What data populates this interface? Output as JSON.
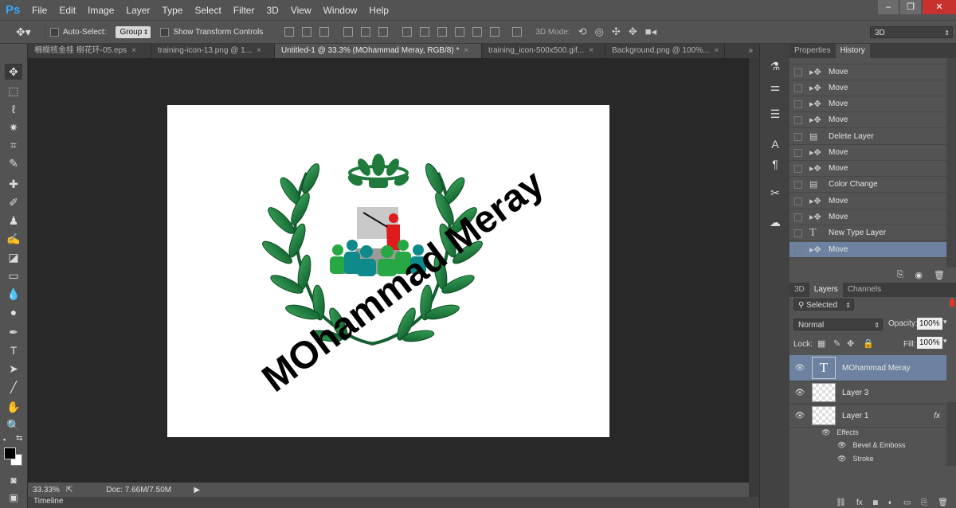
{
  "app": {
    "logo": "Ps"
  },
  "menu": [
    "File",
    "Edit",
    "Image",
    "Layer",
    "Type",
    "Select",
    "Filter",
    "3D",
    "View",
    "Window",
    "Help"
  ],
  "options": {
    "auto_select_label": "Auto-Select:",
    "auto_select_value": "Group",
    "show_transform": "Show Transform Controls",
    "mode_3d_label": "3D Mode:",
    "workspace": "3D"
  },
  "tabs": [
    "柵欄核金桂 樹花环-05.eps",
    "training-icon-13.png @ 1...",
    "Untitled-1 @ 33.3% (MOhammad Meray, RGB/8) *",
    "training_icon-500x500.gif...",
    "Background.png @ 100%..."
  ],
  "canvas": {
    "text": "MOhammad Meray"
  },
  "status": {
    "zoom": "33.33%",
    "doc": "Doc: 7.66M/7.50M"
  },
  "timeline": "Timeline",
  "history": {
    "tabs": [
      "Properties",
      "History"
    ],
    "rows": [
      {
        "label": "Move",
        "icon": "move"
      },
      {
        "label": "Move",
        "icon": "move"
      },
      {
        "label": "Move",
        "icon": "move"
      },
      {
        "label": "Move",
        "icon": "move"
      },
      {
        "label": "Delete Layer",
        "icon": "doc"
      },
      {
        "label": "Move",
        "icon": "move"
      },
      {
        "label": "Move",
        "icon": "move"
      },
      {
        "label": "Color Change",
        "icon": "doc"
      },
      {
        "label": "Move",
        "icon": "move"
      },
      {
        "label": "Move",
        "icon": "move"
      },
      {
        "label": "New Type Layer",
        "icon": "type"
      },
      {
        "label": "Move",
        "icon": "move"
      }
    ]
  },
  "layers": {
    "tabs": [
      "3D",
      "Layers",
      "Channels"
    ],
    "filter": "Selected",
    "blend": "Normal",
    "opacity_label": "Opacity:",
    "opacity": "100%",
    "lock_label": "Lock:",
    "fill_label": "Fill:",
    "fill": "100%",
    "items": [
      {
        "name": "MOhammad Meray",
        "type": "text"
      },
      {
        "name": "Layer 3",
        "type": "image"
      },
      {
        "name": "Layer 1",
        "type": "image",
        "fx": "fx"
      }
    ],
    "effects_label": "Effects",
    "effects": [
      "Bevel & Emboss",
      "Stroke"
    ]
  }
}
